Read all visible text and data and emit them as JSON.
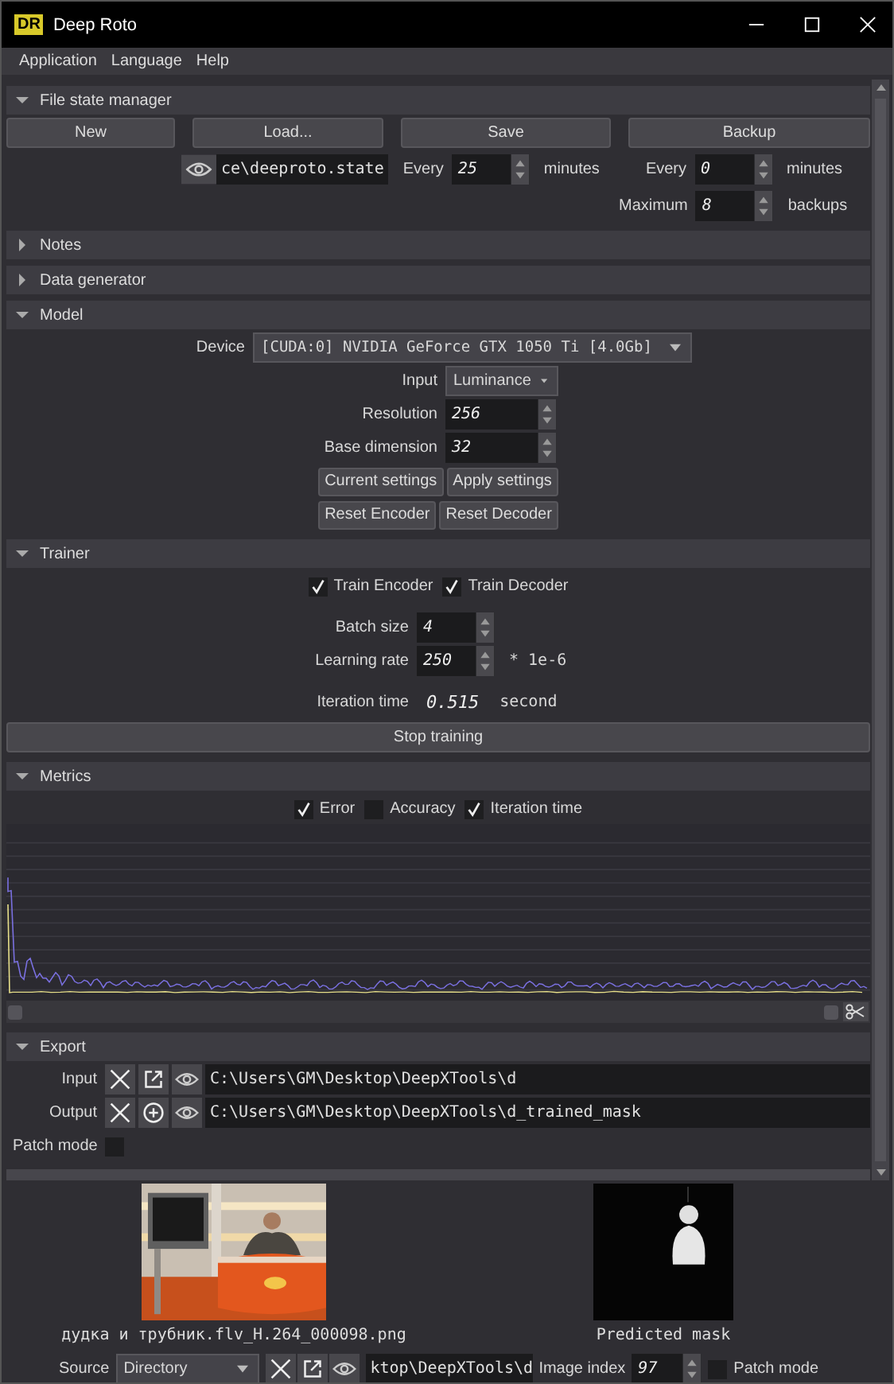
{
  "window": {
    "logo": "DR",
    "title": "Deep Roto"
  },
  "menu": [
    "Application",
    "Language",
    "Help"
  ],
  "sections": [
    {
      "kind": "file_state",
      "title": "File state manager",
      "expanded": true,
      "buttons": [
        "New",
        "Load...",
        "Save",
        "Backup"
      ],
      "state_file": "ce\\deeproto.state",
      "autosave": {
        "label": "Every",
        "value": "25",
        "unit": "minutes"
      },
      "backup_every": {
        "label": "Every",
        "value": "0",
        "unit": "minutes"
      },
      "backup_max": {
        "label": "Maximum",
        "value": "8",
        "unit": "backups"
      }
    },
    {
      "kind": "notes",
      "title": "Notes",
      "expanded": false
    },
    {
      "kind": "data_generator",
      "title": "Data generator",
      "expanded": false
    },
    {
      "kind": "model",
      "title": "Model",
      "expanded": true,
      "device": {
        "label": "Device",
        "value": "[CUDA:0] NVIDIA GeForce GTX 1050 Ti [4.0Gb]"
      },
      "input": {
        "label": "Input",
        "value": "Luminance"
      },
      "resolution": {
        "label": "Resolution",
        "value": "256"
      },
      "base_dimension": {
        "label": "Base dimension",
        "value": "32"
      },
      "button_rows": [
        [
          "Current settings",
          "Apply settings"
        ],
        [
          "Reset Encoder",
          "Reset Decoder"
        ]
      ]
    },
    {
      "kind": "trainer",
      "title": "Trainer",
      "expanded": true,
      "checks": [
        {
          "label": "Train Encoder",
          "checked": true
        },
        {
          "label": "Train Decoder",
          "checked": true
        }
      ],
      "batch_size": {
        "label": "Batch size",
        "value": "4"
      },
      "learning_rate": {
        "label": "Learning rate",
        "value": "250",
        "suffix": "* 1e-6"
      },
      "iteration_time": {
        "label": "Iteration time",
        "value": "0.515",
        "unit": "second"
      },
      "button": "Stop training"
    },
    {
      "kind": "metrics",
      "title": "Metrics",
      "expanded": true,
      "checks": [
        {
          "label": "Error",
          "checked": true
        },
        {
          "label": "Accuracy",
          "checked": false
        },
        {
          "label": "Iteration time",
          "checked": true
        }
      ]
    },
    {
      "kind": "export",
      "title": "Export",
      "expanded": true,
      "rows": [
        {
          "label": "Input",
          "kind": "open",
          "path": "C:\\Users\\GM\\Desktop\\DeepXTools\\d"
        },
        {
          "label": "Output",
          "kind": "add",
          "path": "C:\\Users\\GM\\Desktop\\DeepXTools\\d_trained_mask"
        }
      ],
      "patch_mode": {
        "label": "Patch mode",
        "checked": false
      }
    }
  ],
  "preview": {
    "input_caption": "дудка и трубник.flv_H.264_000098.png",
    "mask_caption": "Predicted mask",
    "source": {
      "label": "Source",
      "value": "Directory",
      "path": "ktop\\DeepXTools\\d"
    },
    "image_index": {
      "label": "Image index",
      "value": "97"
    },
    "patch_mode": {
      "label": "Patch mode",
      "checked": false
    }
  }
}
